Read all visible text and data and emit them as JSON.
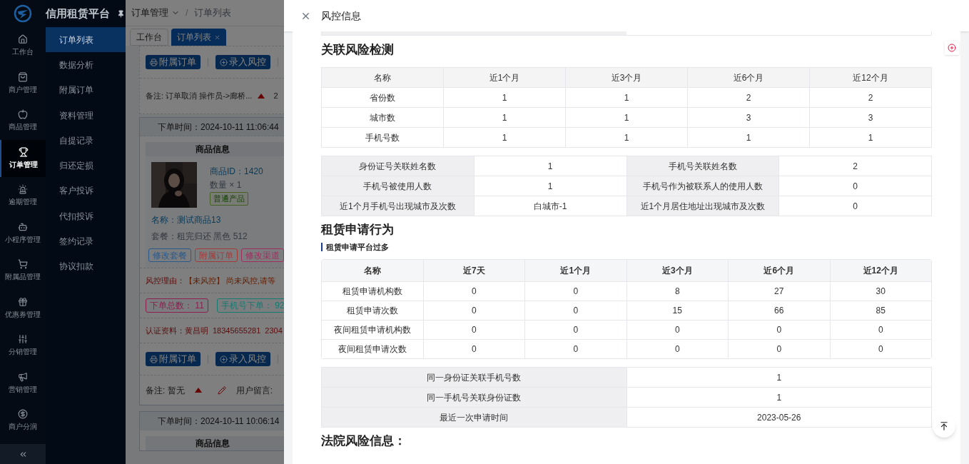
{
  "app_title": "信用租赁平台",
  "nav_rail": [
    {
      "label": "工作台",
      "selected": false
    },
    {
      "label": "商户管理",
      "selected": false
    },
    {
      "label": "商品管理",
      "selected": false
    },
    {
      "label": "订单管理",
      "selected": true
    },
    {
      "label": "逾期管理",
      "selected": false
    },
    {
      "label": "小程序管理",
      "selected": false
    },
    {
      "label": "附属品管理",
      "selected": false
    },
    {
      "label": "优惠券管理",
      "selected": false
    },
    {
      "label": "分销管理",
      "selected": false
    },
    {
      "label": "营销管理",
      "selected": false
    },
    {
      "label": "商户分润",
      "selected": false
    }
  ],
  "submenu": [
    {
      "label": "订单列表",
      "selected": true
    },
    {
      "label": "数据分析",
      "selected": false
    },
    {
      "label": "附属订单",
      "selected": false
    },
    {
      "label": "资料管理",
      "selected": false
    },
    {
      "label": "自提记录",
      "selected": false
    },
    {
      "label": "归还定损",
      "selected": false
    },
    {
      "label": "客户投诉",
      "selected": false
    },
    {
      "label": "代扣投诉",
      "selected": false
    },
    {
      "label": "签约记录",
      "selected": false
    },
    {
      "label": "协议扣款",
      "selected": false
    }
  ],
  "breadcrumb": [
    "订单管理",
    "订单列表"
  ],
  "breadcrumb_separator": "/",
  "tabs": [
    {
      "label": "工作台",
      "selected": false,
      "closable": false
    },
    {
      "label": "订单列表",
      "selected": true,
      "closable": true
    }
  ],
  "order_actions": [
    "附属订单",
    "录入风控"
  ],
  "first_note": {
    "text": "备注: 订单取消 操作员->廊桥...",
    "extra": "2"
  },
  "order": {
    "time": "下单时间：2024-10-11 11:06:44",
    "section": "商品信息",
    "product_id": "商品ID：1420",
    "quantity": "数量 × 1",
    "tag": "普通产品",
    "name": "名称：测试商品13",
    "package": "套餐：租完归还 黑色 512",
    "edit_buttons": [
      {
        "label": "修改套餐",
        "color": "#2a5a8c"
      },
      {
        "label": "附属订单",
        "color": "#a33a3a"
      },
      {
        "label": "修改渠道",
        "color": "#a12d5e"
      }
    ],
    "risk_label": "风控理由：",
    "risk_text": "【未风控】 尚未风控,请等",
    "counts": [
      {
        "label": "下单总数：",
        "value": "11",
        "color": "#8c1f4f"
      },
      {
        "label": "手机号下单：",
        "value": "92",
        "color": "#157a70"
      }
    ],
    "auth_label": "认证资料：",
    "auth_name": "黄昌明",
    "auth_phone": "18345655281",
    "auth_id": "2304",
    "actions": [
      "附属订单",
      "录入风控"
    ],
    "note": "备注: 暂无",
    "message_label": "用户留言:"
  },
  "next_order": {
    "time": "下单时间：2024-10-11 10:06:14",
    "section": "商品信息"
  },
  "drawer": {
    "title": "风控信息",
    "sections": [
      {
        "kind": "heading",
        "text": "关联风险检测"
      },
      {
        "kind": "grid",
        "columns": [
          "名称",
          "近1个月",
          "近3个月",
          "近6个月",
          "近12个月"
        ],
        "rows": [
          [
            "省份数",
            "1",
            "1",
            "2",
            "2"
          ],
          [
            "城市数",
            "1",
            "1",
            "3",
            "3"
          ],
          [
            "手机号数",
            "1",
            "1",
            "1",
            "1"
          ]
        ]
      },
      {
        "kind": "pairs",
        "rows": [
          [
            "身份证号关联姓名数",
            "1",
            "手机号关联姓名数",
            "2"
          ],
          [
            "手机号被使用人数",
            "1",
            "手机号作为被联系人的使用人数",
            "0"
          ],
          [
            "近1个月手机号出现城市及次数",
            "白城市-1",
            "近1个月居住地址出现城市及次数",
            "0"
          ]
        ]
      },
      {
        "kind": "heading",
        "text": "租赁申请行为"
      },
      {
        "kind": "subheading",
        "text": "租赁申请平台过多"
      },
      {
        "kind": "grid",
        "columns": [
          "名称",
          "近7天",
          "近1个月",
          "近3个月",
          "近6个月",
          "近12个月"
        ],
        "rows": [
          [
            "租赁申请机构数",
            "0",
            "0",
            "8",
            "27",
            "30"
          ],
          [
            "租赁申请次数",
            "0",
            "0",
            "15",
            "66",
            "85"
          ],
          [
            "夜间租赁申请机构数",
            "0",
            "0",
            "0",
            "0",
            "0"
          ],
          [
            "夜间租赁申请次数",
            "0",
            "0",
            "0",
            "0",
            "0"
          ]
        ]
      },
      {
        "kind": "pairs",
        "rows": [
          [
            "同一身份证关联手机号数",
            "1"
          ],
          [
            "同一手机号关联身份证数",
            "1"
          ],
          [
            "最近一次申请时间",
            "2023-05-26"
          ]
        ]
      },
      {
        "kind": "heading",
        "text": "法院风险信息："
      }
    ]
  }
}
